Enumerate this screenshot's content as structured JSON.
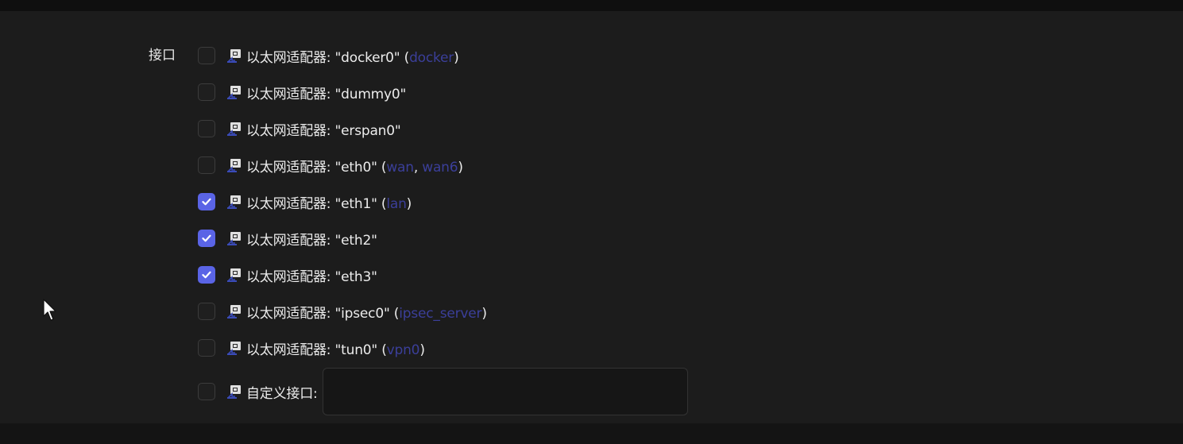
{
  "field": {
    "label": "接口"
  },
  "interfaces": [
    {
      "prefix": "以太网适配器: ",
      "device": "\"docker0\"",
      "networks": [
        "docker"
      ],
      "checked": false
    },
    {
      "prefix": "以太网适配器: ",
      "device": "\"dummy0\"",
      "networks": [],
      "checked": false
    },
    {
      "prefix": "以太网适配器: ",
      "device": "\"erspan0\"",
      "networks": [],
      "checked": false
    },
    {
      "prefix": "以太网适配器: ",
      "device": "\"eth0\"",
      "networks": [
        "wan",
        "wan6"
      ],
      "checked": false
    },
    {
      "prefix": "以太网适配器: ",
      "device": "\"eth1\"",
      "networks": [
        "lan"
      ],
      "checked": true
    },
    {
      "prefix": "以太网适配器: ",
      "device": "\"eth2\"",
      "networks": [],
      "checked": true
    },
    {
      "prefix": "以太网适配器: ",
      "device": "\"eth3\"",
      "networks": [],
      "checked": true
    },
    {
      "prefix": "以太网适配器: ",
      "device": "\"ipsec0\"",
      "networks": [
        "ipsec_server"
      ],
      "checked": false
    },
    {
      "prefix": "以太网适配器: ",
      "device": "\"tun0\"",
      "networks": [
        "vpn0"
      ],
      "checked": false
    }
  ],
  "custom": {
    "label": "自定义接口:",
    "value": "",
    "checked": false
  },
  "icons": {
    "row_icon": "ethernet-adapter-icon",
    "cursor": "mouse-pointer-icon"
  },
  "colors": {
    "accent": "#5a64e6",
    "network_link": "#3b3f9a",
    "background": "#1c1c1c"
  }
}
